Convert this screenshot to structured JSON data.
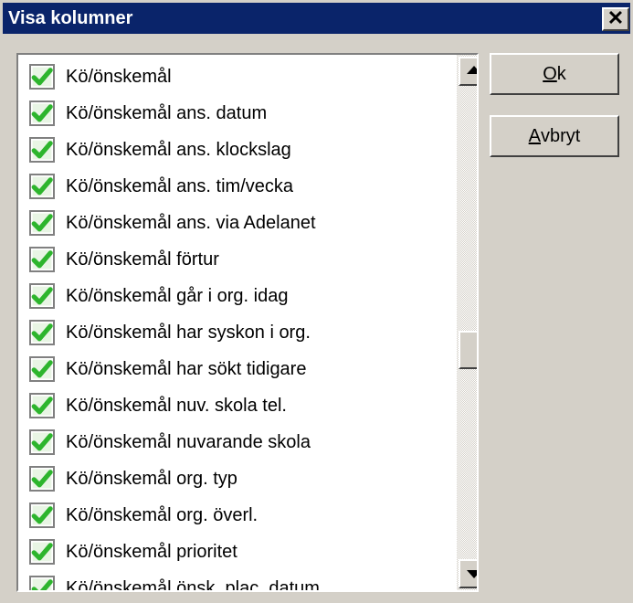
{
  "window": {
    "title": "Visa kolumner",
    "close_glyph": "✕"
  },
  "list": {
    "items": [
      {
        "label": "Kö/önskemål",
        "checked": true
      },
      {
        "label": "Kö/önskemål ans. datum",
        "checked": true
      },
      {
        "label": "Kö/önskemål ans. klockslag",
        "checked": true
      },
      {
        "label": "Kö/önskemål ans. tim/vecka",
        "checked": true
      },
      {
        "label": "Kö/önskemål ans. via Adelanet",
        "checked": true
      },
      {
        "label": "Kö/önskemål förtur",
        "checked": true
      },
      {
        "label": "Kö/önskemål går i org. idag",
        "checked": true
      },
      {
        "label": "Kö/önskemål har syskon i org.",
        "checked": true
      },
      {
        "label": "Kö/önskemål har sökt tidigare",
        "checked": true
      },
      {
        "label": "Kö/önskemål nuv. skola tel.",
        "checked": true
      },
      {
        "label": "Kö/önskemål nuvarande skola",
        "checked": true
      },
      {
        "label": "Kö/önskemål org. typ",
        "checked": true
      },
      {
        "label": "Kö/önskemål org. överl.",
        "checked": true
      },
      {
        "label": "Kö/önskemål prioritet",
        "checked": true
      },
      {
        "label": "Kö/önskemål önsk. plac. datum",
        "checked": true
      }
    ],
    "scroll_position_fraction": 0.55
  },
  "buttons": {
    "ok": {
      "mnemonic": "O",
      "rest": "k"
    },
    "cancel": {
      "mnemonic": "A",
      "rest": "vbryt"
    }
  },
  "colors": {
    "titlebar": "#0a246a",
    "dialog_face": "#d4d0c8",
    "checkmark_green": "#2db52d"
  },
  "icons": {
    "checkbox": "checkbox-checked-icon",
    "scroll_up": "scroll-up-arrow-icon",
    "scroll_down": "scroll-down-arrow-icon",
    "close": "close-icon"
  }
}
